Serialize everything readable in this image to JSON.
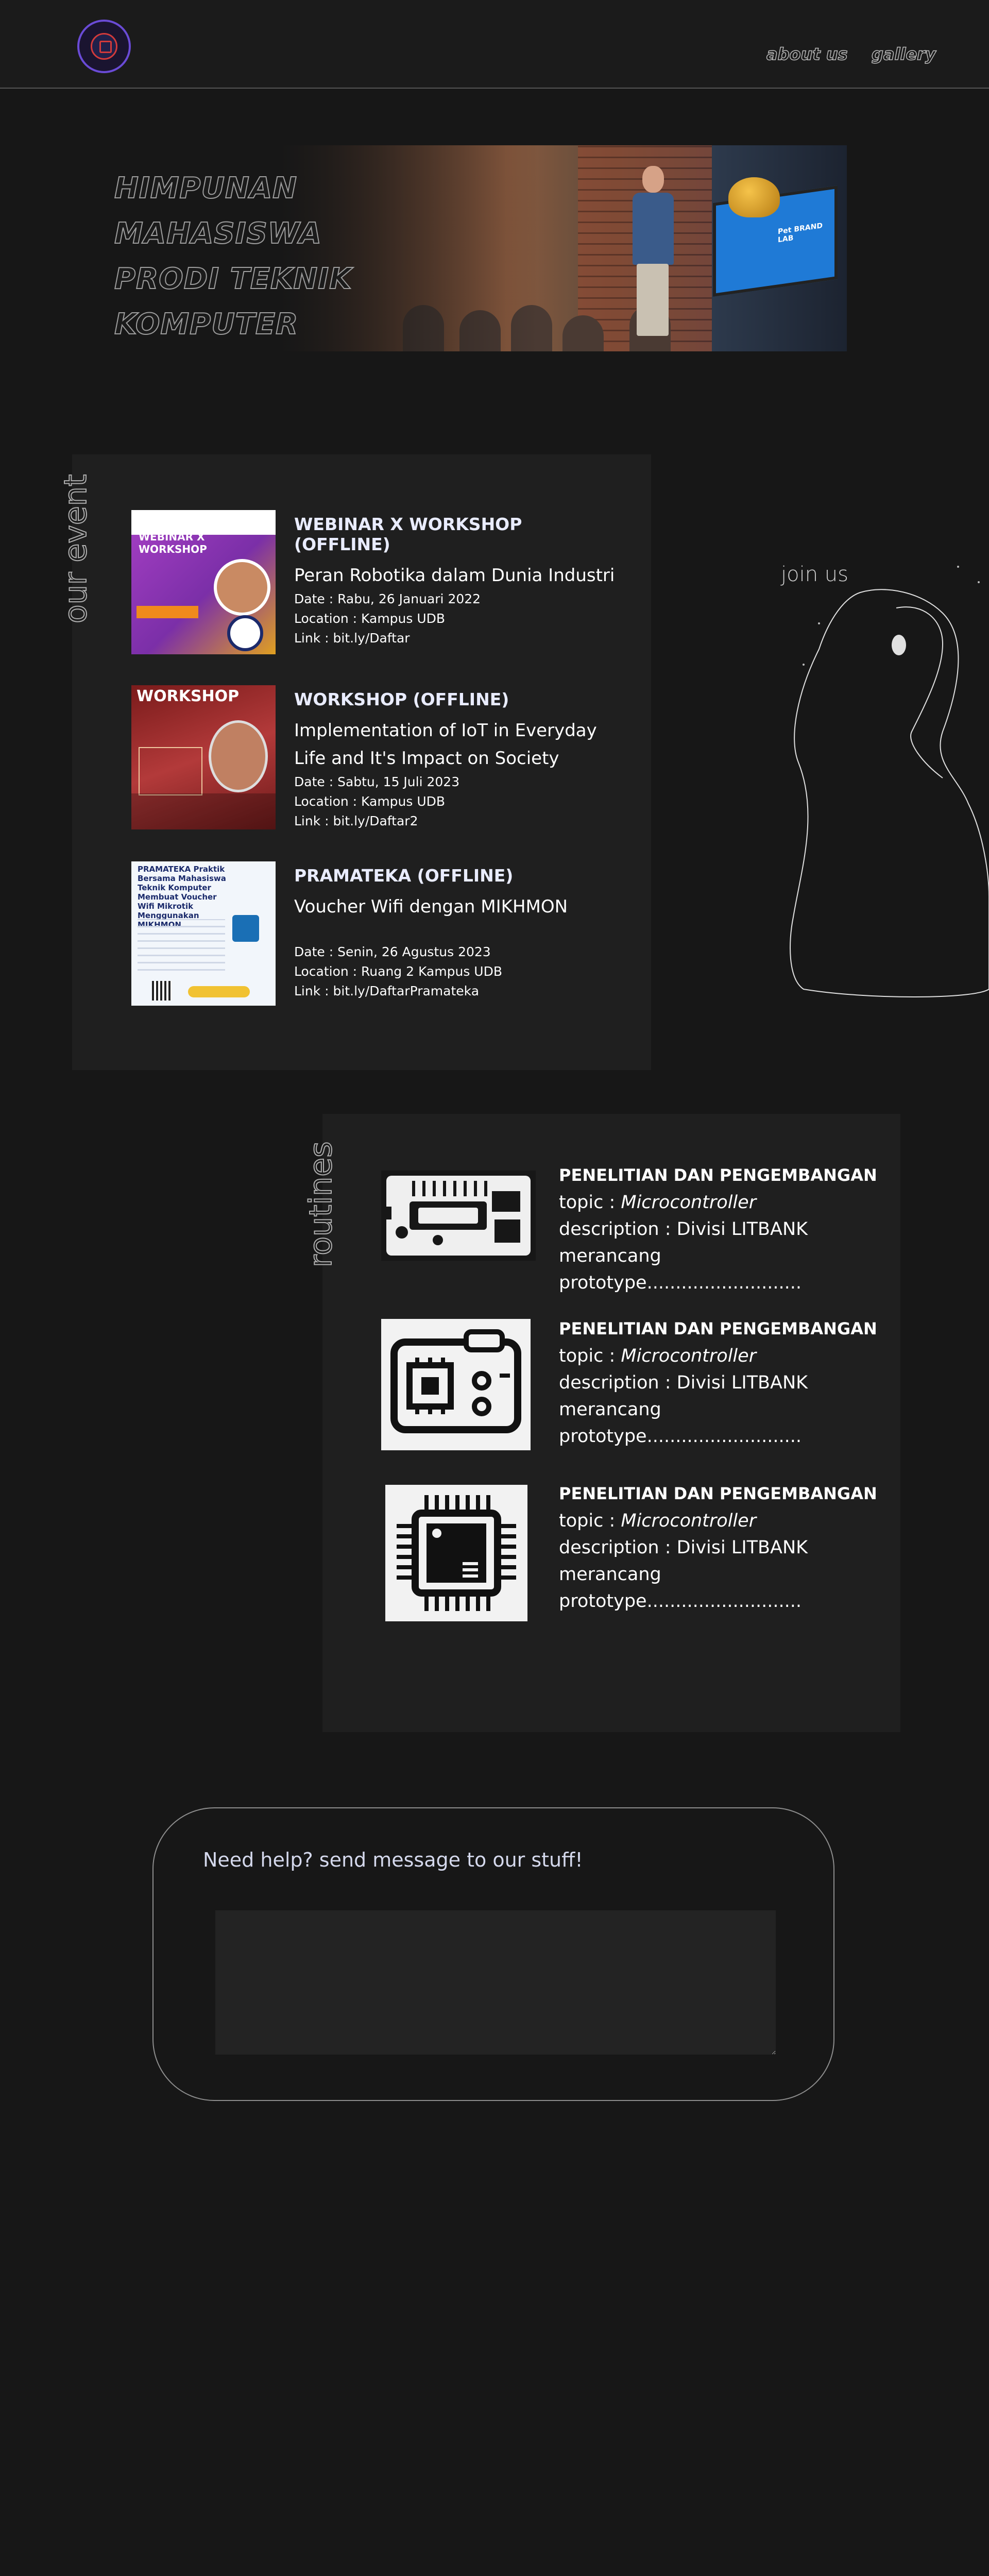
{
  "nav": {
    "logo_alt": "HMPS TK logo",
    "links": [
      "about us",
      "gallery"
    ]
  },
  "hero": {
    "title_lines": [
      "HIMPUNAN",
      "MAHASISWA",
      "PRODI TEKNIK",
      "KOMPUTER"
    ],
    "screen_text": "Pet BRAND LAB"
  },
  "events": {
    "section_label": "our event",
    "items": [
      {
        "type": "WEBINAR X WORKSHOP (OFFLINE)",
        "title": "Peran Robotika dalam Dunia Industri",
        "date": "Date :  Rabu, 26 Januari 2022",
        "location": "Location : Kampus UDB",
        "link": "Link : bit.ly/Daftar",
        "poster_text": "WEBINAR X WORKSHOP"
      },
      {
        "type": "WORKSHOP (OFFLINE)",
        "title": "Implementation of IoT in Everyday Life and It's Impact on Society",
        "date": "Date :  Sabtu, 15 Juli 2023",
        "location": "Location : Kampus UDB",
        "link": "Link : bit.ly/Daftar2",
        "poster_text": "WORKSHOP"
      },
      {
        "type": "PRAMATEKA (OFFLINE)",
        "title": "Voucher Wifi dengan MIKHMON",
        "date": "Date :  Senin, 26 Agustus 2023",
        "location": "Location : Ruang 2 Kampus UDB",
        "link": "Link : bit.ly/DaftarPramateka",
        "poster_text": "PRAMATEKA Praktik Bersama Mahasiswa Teknik Komputer Membuat Voucher Wifi Mikrotik Menggunakan MIKHMON"
      }
    ]
  },
  "join": {
    "label": "join us"
  },
  "routines": {
    "section_label": "routines",
    "items": [
      {
        "title": "PENELITIAN DAN PENGEMBANGAN",
        "topic_prefix": "topic : ",
        "topic": "Microcontroller",
        "description": "description : Divisi LITBANK",
        "detail": "merancang prototype...........................",
        "icon": "circuit-board-icon"
      },
      {
        "title": "PENELITIAN DAN PENGEMBANGAN",
        "topic_prefix": "topic : ",
        "topic": "Microcontroller",
        "description": "description : Divisi LITBANK",
        "detail": "merancang prototype...........................",
        "icon": "microcontroller-board-icon"
      },
      {
        "title": "PENELITIAN DAN PENGEMBANGAN",
        "topic_prefix": "topic : ",
        "topic": "Microcontroller",
        "description": "description : Divisi LITBANK",
        "detail": "merancang prototype...........................",
        "icon": "chip-icon"
      }
    ]
  },
  "help": {
    "title": "Need help? send message to our stuff!",
    "message_value": ""
  }
}
